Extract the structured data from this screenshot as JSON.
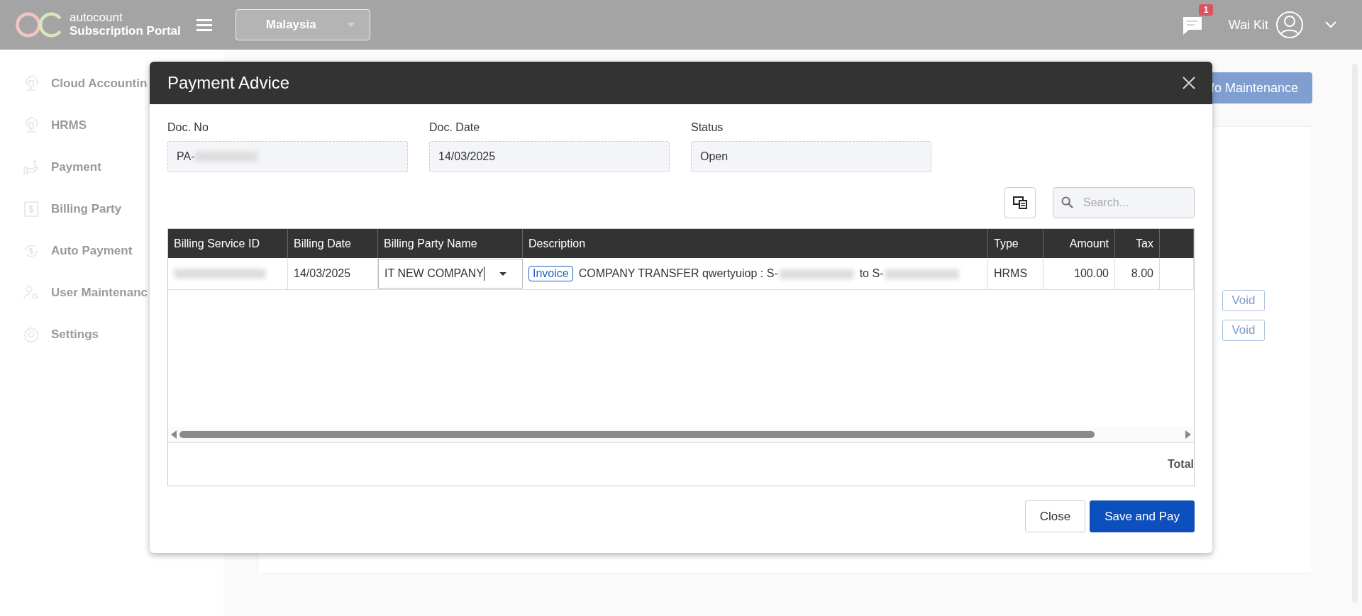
{
  "header": {
    "brand_top": "autocount",
    "brand_bottom": "Subscription Portal",
    "country": "Malaysia",
    "notification_count": "1",
    "user_name": "Wai Kit"
  },
  "sidebar": {
    "items": [
      {
        "label": "Cloud Accountin"
      },
      {
        "label": "HRMS"
      },
      {
        "label": "Payment"
      },
      {
        "label": "Billing Party"
      },
      {
        "label": "Auto Payment"
      },
      {
        "label": "User Maintenanc"
      },
      {
        "label": "Settings"
      }
    ]
  },
  "background": {
    "action_button": "fo Maintenance",
    "void_buttons": [
      "Void",
      "Void"
    ]
  },
  "modal": {
    "title": "Payment Advice",
    "fields": [
      {
        "label": "Doc. No",
        "value": "PA-",
        "redacted": true
      },
      {
        "label": "Doc. Date",
        "value": "14/03/2025",
        "redacted": false
      },
      {
        "label": "Status",
        "value": "Open",
        "redacted": false
      }
    ],
    "search": {
      "placeholder": "Search..."
    },
    "table": {
      "columns": [
        {
          "label": "Billing Service ID"
        },
        {
          "label": "Billing Date"
        },
        {
          "label": "Billing Party Name"
        },
        {
          "label": "Description"
        },
        {
          "label": "Type"
        },
        {
          "label": "Amount"
        },
        {
          "label": "Tax"
        }
      ],
      "rows": [
        {
          "billing_service_id_redacted": true,
          "billing_date": "14/03/2025",
          "billing_party_name": "IT NEW COMPANY",
          "tag": "Invoice",
          "description": [
            {
              "text": "COMPANY TRANSFER qwertyuiop : S-",
              "redacted_after": true
            },
            {
              "text": "to S-",
              "redacted_after": true
            }
          ],
          "type": "HRMS",
          "amount": "100.00",
          "tax": "8.00"
        }
      ],
      "total_label": "Total"
    },
    "buttons": [
      {
        "label": "Close",
        "kind": "secondary"
      },
      {
        "label": "Save and Pay",
        "kind": "primary"
      }
    ]
  }
}
